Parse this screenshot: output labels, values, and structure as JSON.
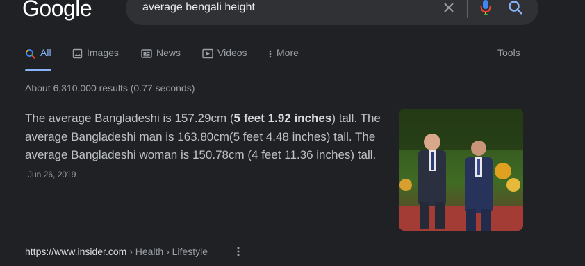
{
  "header": {
    "logo_text": "Google",
    "search_query": "average bengali height",
    "icons": [
      "close-icon",
      "mic-icon",
      "search-icon"
    ]
  },
  "tabs": [
    {
      "label": "All",
      "icon": "search-icon",
      "active": true
    },
    {
      "label": "Images",
      "icon": "image-icon",
      "active": false
    },
    {
      "label": "News",
      "icon": "news-icon",
      "active": false
    },
    {
      "label": "Videos",
      "icon": "video-icon",
      "active": false
    },
    {
      "label": "More",
      "icon": "more-vert-icon",
      "active": false
    }
  ],
  "tools_label": "Tools",
  "result_stats": "About 6,310,000 results (0.77 seconds)",
  "featured_snippet": {
    "text_before": "The average Bangladeshi is 157.29cm (",
    "bold": "5 feet 1.92 inches",
    "text_after": ") tall. The average Bangladeshi man is 163.80cm(5 feet 4.48 inches) tall. The average Bangladeshi woman is 150.78cm (4 feet 11.36 inches) tall.",
    "date": "Jun 26, 2019",
    "image": "two-men-in-suits-photo"
  },
  "source": {
    "domain": "https://www.insider.com",
    "path": " › Health › Lifestyle"
  },
  "colors": {
    "background": "#202124",
    "active_tab": "#8ab4f8",
    "text": "#bdc1c6"
  }
}
